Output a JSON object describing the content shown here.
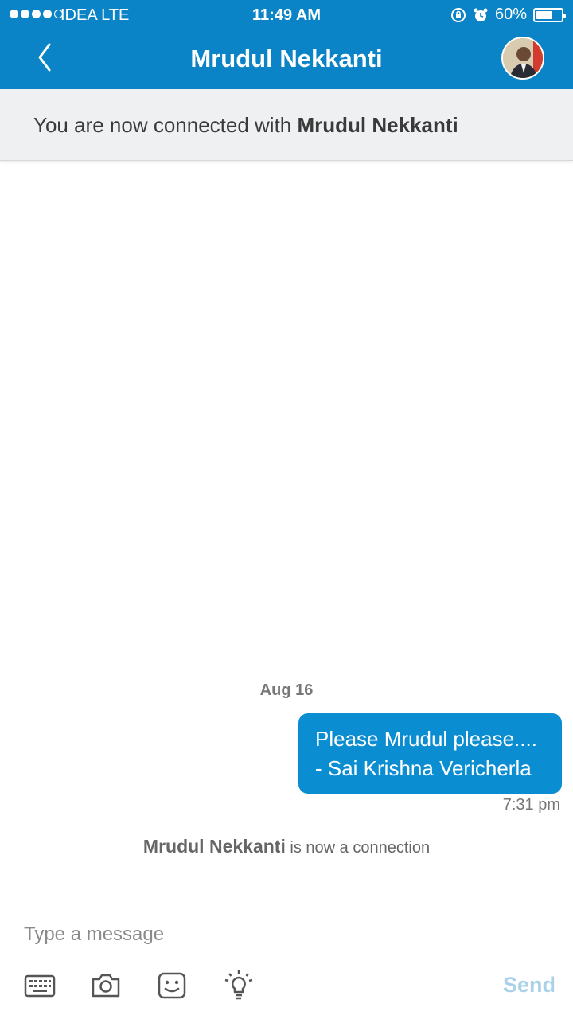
{
  "status_bar": {
    "carrier": "IDEA   LTE",
    "time": "11:49 AM",
    "battery": "60%"
  },
  "header": {
    "title": "Mrudul Nekkanti",
    "back_icon": "chevron-left-icon",
    "avatar_icon": "avatar"
  },
  "banner": {
    "prefix": "You are now connected with ",
    "name": "Mrudul Nekkanti"
  },
  "conversation": {
    "date": "Aug 16",
    "messages": [
      {
        "lines": [
          "Please Mrudul please....",
          "- Sai Krishna Vericherla"
        ],
        "time": "7:31 pm"
      }
    ],
    "connection_note": {
      "name": "Mrudul Nekkanti",
      "text": " is now a connection"
    }
  },
  "composer": {
    "placeholder": "Type a message",
    "send_label": "Send",
    "tools": [
      "keyboard-icon",
      "camera-icon",
      "emoji-icon",
      "lightbulb-icon"
    ]
  },
  "colors": {
    "brand": "#0a84c6",
    "bubble": "#0b8dd1",
    "send_disabled": "#a9d2ea"
  }
}
